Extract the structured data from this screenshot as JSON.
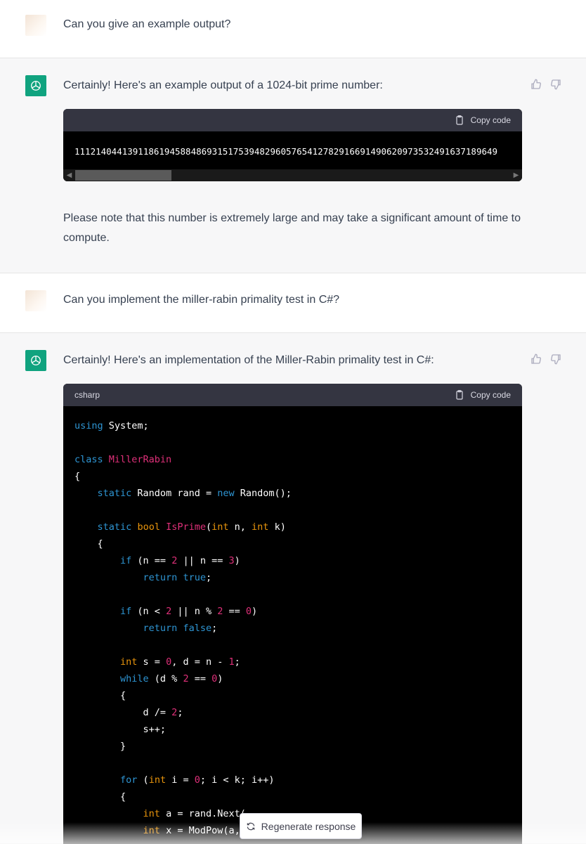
{
  "messages": [
    {
      "role": "user",
      "text": "Can you give an example output?"
    },
    {
      "role": "assistant",
      "intro": "Certainly! Here's an example output of a 1024-bit prime number:",
      "code_lang": "",
      "code_text": "11121404413911861945884869315175394829605765412782916691490620973532491637189649",
      "after": "Please note that this number is extremely large and may take a significant amount of time to compute."
    },
    {
      "role": "user",
      "text": "Can you implement the miller-rabin primality test in C#?"
    },
    {
      "role": "assistant",
      "intro": "Certainly! Here's an implementation of the Miller-Rabin primality test in C#:",
      "code_lang": "csharp"
    }
  ],
  "copy_label": "Copy code",
  "regenerate_label": "Regenerate response",
  "icons": {
    "thumbs_up": "thumbs-up-icon",
    "thumbs_down": "thumbs-down-icon",
    "copy": "clipboard-icon",
    "regenerate": "refresh-icon",
    "bot": "openai-logo-icon"
  },
  "colors": {
    "accent": "#10a37f",
    "keyword": "#2e95d3",
    "type": "#e9950c",
    "class_name": "#df3079",
    "number": "#df3079"
  },
  "code_lines": [
    [
      {
        "t": "using",
        "c": "kw"
      },
      {
        "t": " System;"
      }
    ],
    [],
    [
      {
        "t": "class",
        "c": "kw"
      },
      {
        "t": " "
      },
      {
        "t": "MillerRabin",
        "c": "cls"
      }
    ],
    [
      {
        "t": "{"
      }
    ],
    [
      {
        "t": "    "
      },
      {
        "t": "static",
        "c": "kw"
      },
      {
        "t": " Random rand = "
      },
      {
        "t": "new",
        "c": "kw"
      },
      {
        "t": " Random();"
      }
    ],
    [],
    [
      {
        "t": "    "
      },
      {
        "t": "static",
        "c": "kw"
      },
      {
        "t": " "
      },
      {
        "t": "bool",
        "c": "ty"
      },
      {
        "t": " "
      },
      {
        "t": "IsPrime",
        "c": "cls"
      },
      {
        "t": "("
      },
      {
        "t": "int",
        "c": "ty"
      },
      {
        "t": " n, "
      },
      {
        "t": "int",
        "c": "ty"
      },
      {
        "t": " k)"
      }
    ],
    [
      {
        "t": "    {"
      }
    ],
    [
      {
        "t": "        "
      },
      {
        "t": "if",
        "c": "kw"
      },
      {
        "t": " (n == "
      },
      {
        "t": "2",
        "c": "num"
      },
      {
        "t": " || n == "
      },
      {
        "t": "3",
        "c": "num"
      },
      {
        "t": ")"
      }
    ],
    [
      {
        "t": "            "
      },
      {
        "t": "return",
        "c": "kw"
      },
      {
        "t": " "
      },
      {
        "t": "true",
        "c": "kw"
      },
      {
        "t": ";"
      }
    ],
    [],
    [
      {
        "t": "        "
      },
      {
        "t": "if",
        "c": "kw"
      },
      {
        "t": " (n < "
      },
      {
        "t": "2",
        "c": "num"
      },
      {
        "t": " || n % "
      },
      {
        "t": "2",
        "c": "num"
      },
      {
        "t": " == "
      },
      {
        "t": "0",
        "c": "num"
      },
      {
        "t": ")"
      }
    ],
    [
      {
        "t": "            "
      },
      {
        "t": "return",
        "c": "kw"
      },
      {
        "t": " "
      },
      {
        "t": "false",
        "c": "kw"
      },
      {
        "t": ";"
      }
    ],
    [],
    [
      {
        "t": "        "
      },
      {
        "t": "int",
        "c": "ty"
      },
      {
        "t": " s = "
      },
      {
        "t": "0",
        "c": "num"
      },
      {
        "t": ", d = n - "
      },
      {
        "t": "1",
        "c": "num"
      },
      {
        "t": ";"
      }
    ],
    [
      {
        "t": "        "
      },
      {
        "t": "while",
        "c": "kw"
      },
      {
        "t": " (d % "
      },
      {
        "t": "2",
        "c": "num"
      },
      {
        "t": " == "
      },
      {
        "t": "0",
        "c": "num"
      },
      {
        "t": ")"
      }
    ],
    [
      {
        "t": "        {"
      }
    ],
    [
      {
        "t": "            d /= "
      },
      {
        "t": "2",
        "c": "num"
      },
      {
        "t": ";"
      }
    ],
    [
      {
        "t": "            s++;"
      }
    ],
    [
      {
        "t": "        }"
      }
    ],
    [],
    [
      {
        "t": "        "
      },
      {
        "t": "for",
        "c": "kw"
      },
      {
        "t": " ("
      },
      {
        "t": "int",
        "c": "ty"
      },
      {
        "t": " i = "
      },
      {
        "t": "0",
        "c": "num"
      },
      {
        "t": "; i < k; i++)"
      }
    ],
    [
      {
        "t": "        {"
      }
    ],
    [
      {
        "t": "            "
      },
      {
        "t": "int",
        "c": "ty"
      },
      {
        "t": " a = rand.Next("
      }
    ],
    [
      {
        "t": "            "
      },
      {
        "t": "int",
        "c": "ty"
      },
      {
        "t": " x = ModPow(a,"
      }
    ]
  ]
}
